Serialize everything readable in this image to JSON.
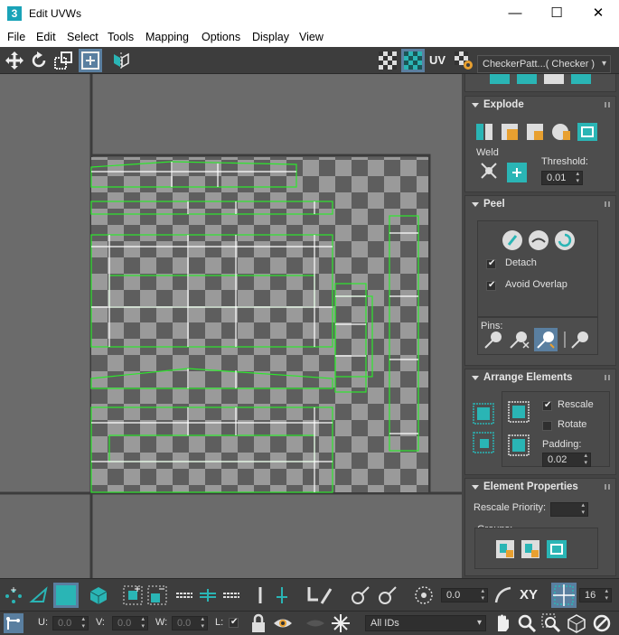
{
  "window": {
    "title": "Edit UVWs",
    "app_icon_label": "3",
    "minimize": "—",
    "maximize": "☐",
    "close": "✕"
  },
  "menu": [
    "File",
    "Edit",
    "Select",
    "Tools",
    "Mapping",
    "Options",
    "Display",
    "View"
  ],
  "toolbar": {
    "uv_label": "UV",
    "texture_dropdown": "CheckerPatt...( Checker )"
  },
  "panel": {
    "explode": {
      "title": "Explode",
      "weld_label": "Weld",
      "threshold_label": "Threshold:",
      "threshold_value": "0.01"
    },
    "peel": {
      "title": "Peel",
      "detach_label": "Detach",
      "detach_checked": true,
      "avoid_overlap_label": "Avoid Overlap",
      "avoid_overlap_checked": true,
      "pins_label": "Pins:"
    },
    "arrange": {
      "title": "Arrange Elements",
      "rescale_label": "Rescale",
      "rescale_checked": true,
      "rotate_label": "Rotate",
      "rotate_checked": false,
      "padding_label": "Padding:",
      "padding_value": "0.02"
    },
    "element_properties": {
      "title": "Element Properties",
      "rescale_priority_label": "Rescale Priority:",
      "rescale_priority_value": "",
      "groups_label": "Groups:"
    }
  },
  "bottom": {
    "rotate_value": "0.0",
    "xy_label": "XY",
    "grid_value": "16",
    "u_label": "U:",
    "u_value": "0.0",
    "v_label": "V:",
    "v_value": "0.0",
    "w_label": "W:",
    "w_value": "0.0",
    "l_label": "L:",
    "ids_dropdown": "All IDs"
  },
  "colors": {
    "accent": "#2ab5b5",
    "uv_shell": "#2ee62e",
    "panel_bg": "#444444",
    "viewport_bg": "#6b6b6b"
  }
}
